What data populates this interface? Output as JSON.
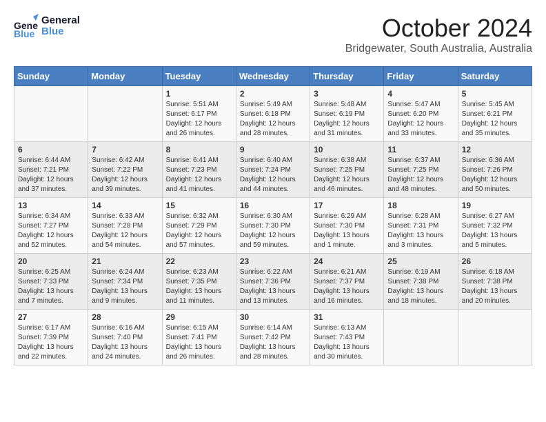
{
  "header": {
    "logo_line1": "General",
    "logo_line2": "Blue",
    "month_title": "October 2024",
    "location": "Bridgewater, South Australia, Australia"
  },
  "days_of_week": [
    "Sunday",
    "Monday",
    "Tuesday",
    "Wednesday",
    "Thursday",
    "Friday",
    "Saturday"
  ],
  "weeks": [
    [
      {
        "day": "",
        "info": ""
      },
      {
        "day": "",
        "info": ""
      },
      {
        "day": "1",
        "info": "Sunrise: 5:51 AM\nSunset: 6:17 PM\nDaylight: 12 hours\nand 26 minutes."
      },
      {
        "day": "2",
        "info": "Sunrise: 5:49 AM\nSunset: 6:18 PM\nDaylight: 12 hours\nand 28 minutes."
      },
      {
        "day": "3",
        "info": "Sunrise: 5:48 AM\nSunset: 6:19 PM\nDaylight: 12 hours\nand 31 minutes."
      },
      {
        "day": "4",
        "info": "Sunrise: 5:47 AM\nSunset: 6:20 PM\nDaylight: 12 hours\nand 33 minutes."
      },
      {
        "day": "5",
        "info": "Sunrise: 5:45 AM\nSunset: 6:21 PM\nDaylight: 12 hours\nand 35 minutes."
      }
    ],
    [
      {
        "day": "6",
        "info": "Sunrise: 6:44 AM\nSunset: 7:21 PM\nDaylight: 12 hours\nand 37 minutes."
      },
      {
        "day": "7",
        "info": "Sunrise: 6:42 AM\nSunset: 7:22 PM\nDaylight: 12 hours\nand 39 minutes."
      },
      {
        "day": "8",
        "info": "Sunrise: 6:41 AM\nSunset: 7:23 PM\nDaylight: 12 hours\nand 41 minutes."
      },
      {
        "day": "9",
        "info": "Sunrise: 6:40 AM\nSunset: 7:24 PM\nDaylight: 12 hours\nand 44 minutes."
      },
      {
        "day": "10",
        "info": "Sunrise: 6:38 AM\nSunset: 7:25 PM\nDaylight: 12 hours\nand 46 minutes."
      },
      {
        "day": "11",
        "info": "Sunrise: 6:37 AM\nSunset: 7:25 PM\nDaylight: 12 hours\nand 48 minutes."
      },
      {
        "day": "12",
        "info": "Sunrise: 6:36 AM\nSunset: 7:26 PM\nDaylight: 12 hours\nand 50 minutes."
      }
    ],
    [
      {
        "day": "13",
        "info": "Sunrise: 6:34 AM\nSunset: 7:27 PM\nDaylight: 12 hours\nand 52 minutes."
      },
      {
        "day": "14",
        "info": "Sunrise: 6:33 AM\nSunset: 7:28 PM\nDaylight: 12 hours\nand 54 minutes."
      },
      {
        "day": "15",
        "info": "Sunrise: 6:32 AM\nSunset: 7:29 PM\nDaylight: 12 hours\nand 57 minutes."
      },
      {
        "day": "16",
        "info": "Sunrise: 6:30 AM\nSunset: 7:30 PM\nDaylight: 12 hours\nand 59 minutes."
      },
      {
        "day": "17",
        "info": "Sunrise: 6:29 AM\nSunset: 7:30 PM\nDaylight: 13 hours\nand 1 minute."
      },
      {
        "day": "18",
        "info": "Sunrise: 6:28 AM\nSunset: 7:31 PM\nDaylight: 13 hours\nand 3 minutes."
      },
      {
        "day": "19",
        "info": "Sunrise: 6:27 AM\nSunset: 7:32 PM\nDaylight: 13 hours\nand 5 minutes."
      }
    ],
    [
      {
        "day": "20",
        "info": "Sunrise: 6:25 AM\nSunset: 7:33 PM\nDaylight: 13 hours\nand 7 minutes."
      },
      {
        "day": "21",
        "info": "Sunrise: 6:24 AM\nSunset: 7:34 PM\nDaylight: 13 hours\nand 9 minutes."
      },
      {
        "day": "22",
        "info": "Sunrise: 6:23 AM\nSunset: 7:35 PM\nDaylight: 13 hours\nand 11 minutes."
      },
      {
        "day": "23",
        "info": "Sunrise: 6:22 AM\nSunset: 7:36 PM\nDaylight: 13 hours\nand 13 minutes."
      },
      {
        "day": "24",
        "info": "Sunrise: 6:21 AM\nSunset: 7:37 PM\nDaylight: 13 hours\nand 16 minutes."
      },
      {
        "day": "25",
        "info": "Sunrise: 6:19 AM\nSunset: 7:38 PM\nDaylight: 13 hours\nand 18 minutes."
      },
      {
        "day": "26",
        "info": "Sunrise: 6:18 AM\nSunset: 7:38 PM\nDaylight: 13 hours\nand 20 minutes."
      }
    ],
    [
      {
        "day": "27",
        "info": "Sunrise: 6:17 AM\nSunset: 7:39 PM\nDaylight: 13 hours\nand 22 minutes."
      },
      {
        "day": "28",
        "info": "Sunrise: 6:16 AM\nSunset: 7:40 PM\nDaylight: 13 hours\nand 24 minutes."
      },
      {
        "day": "29",
        "info": "Sunrise: 6:15 AM\nSunset: 7:41 PM\nDaylight: 13 hours\nand 26 minutes."
      },
      {
        "day": "30",
        "info": "Sunrise: 6:14 AM\nSunset: 7:42 PM\nDaylight: 13 hours\nand 28 minutes."
      },
      {
        "day": "31",
        "info": "Sunrise: 6:13 AM\nSunset: 7:43 PM\nDaylight: 13 hours\nand 30 minutes."
      },
      {
        "day": "",
        "info": ""
      },
      {
        "day": "",
        "info": ""
      }
    ]
  ]
}
